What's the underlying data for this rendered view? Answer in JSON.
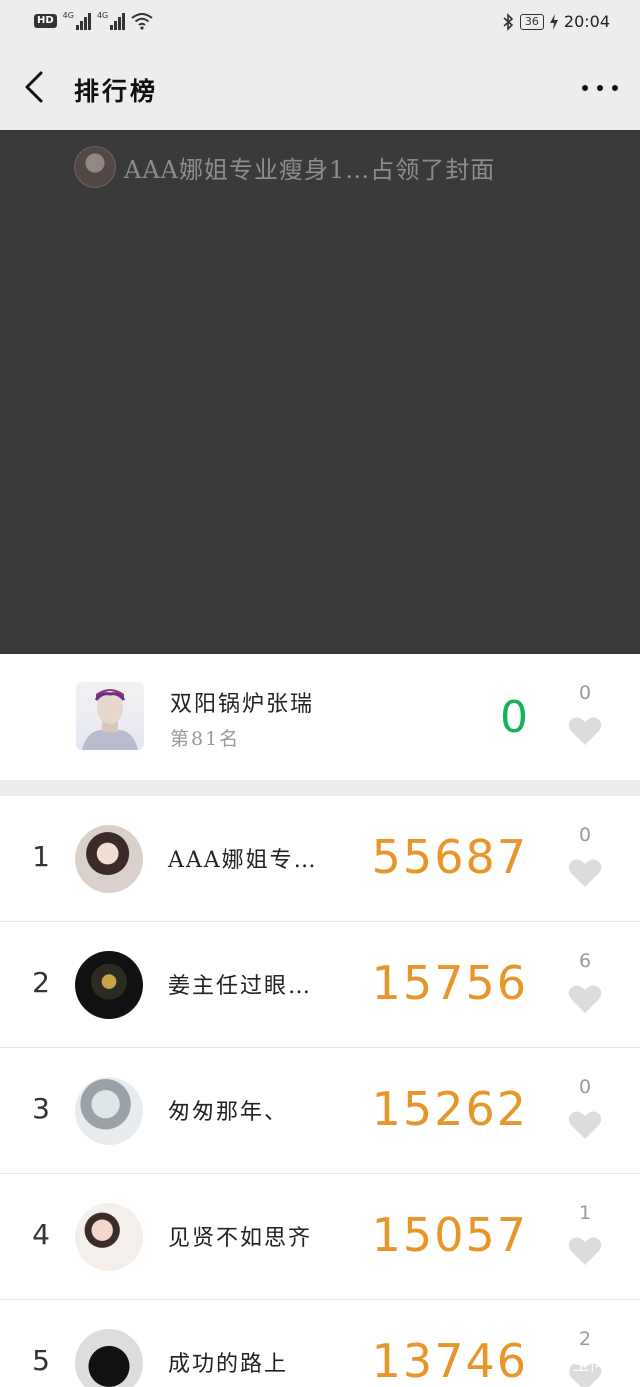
{
  "status_bar": {
    "hd": "HD",
    "network_tag": "4G",
    "battery": "36",
    "time": "20:04"
  },
  "nav": {
    "title": "排行榜"
  },
  "cover": {
    "banner_text": "AAA娜姐专业瘦身1…占领了封面"
  },
  "me": {
    "name": "双阳锅炉张瑞",
    "rank_text": "第81名",
    "steps": "0",
    "likes": "0"
  },
  "ranking": [
    {
      "rank": "1",
      "name": "AAA娜姐专…",
      "steps": "55687",
      "likes": "0"
    },
    {
      "rank": "2",
      "name": "姜主任过眼…",
      "steps": "15756",
      "likes": "6"
    },
    {
      "rank": "3",
      "name": "匆匆那年、",
      "steps": "15262",
      "likes": "0"
    },
    {
      "rank": "4",
      "name": "见贤不如思齐",
      "steps": "15057",
      "likes": "1"
    },
    {
      "rank": "5",
      "name": "成功的路上",
      "steps": "13746",
      "likes": "2"
    }
  ],
  "watermark": "悟空问答",
  "colors": {
    "steps_accent": "#e8952a",
    "my_steps": "#16b25a",
    "cover_bg": "#3a3a3a"
  }
}
